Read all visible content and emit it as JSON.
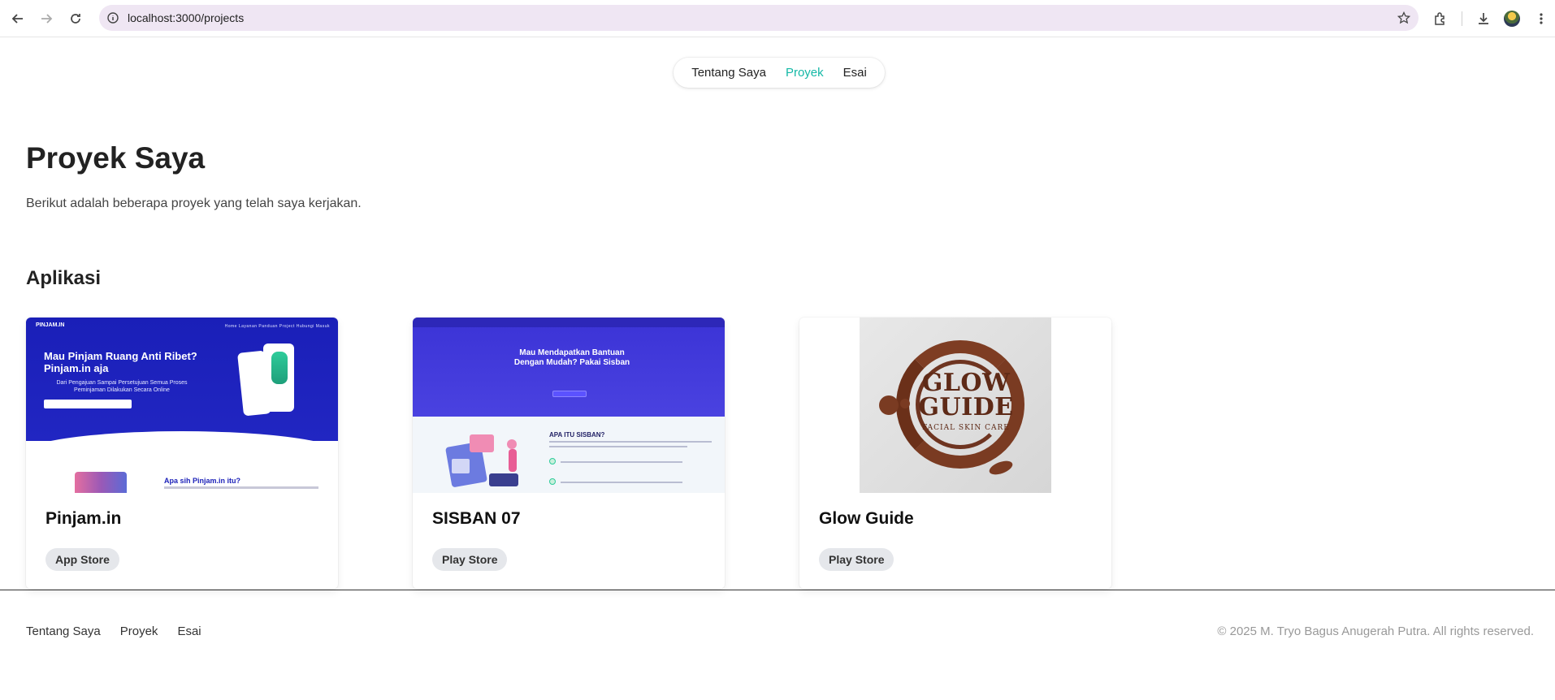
{
  "browser": {
    "url": "localhost:3000/projects",
    "icons": [
      "back-icon",
      "forward-icon",
      "reload-icon",
      "site-info-icon",
      "bookmark-star-icon",
      "extensions-icon",
      "downloads-icon",
      "profile-avatar",
      "more-menu-icon"
    ]
  },
  "nav": {
    "items": [
      {
        "label": "Tentang Saya",
        "active": false
      },
      {
        "label": "Proyek",
        "active": true
      },
      {
        "label": "Esai",
        "active": false
      }
    ],
    "active_color": "#14b8a6"
  },
  "page": {
    "title": "Proyek Saya",
    "subtitle": "Berikut adalah beberapa proyek yang telah saya kerjakan."
  },
  "section": {
    "title": "Aplikasi"
  },
  "projects": [
    {
      "title": "Pinjam.in",
      "store": "App Store",
      "thumb": {
        "logo": "PINJAM.IN",
        "menu": "Home   Layanan   Panduan   Project   Hubungi   Masuk",
        "headline_1": "Mau Pinjam Ruang Anti Ribet?",
        "headline_2": "Pinjam.in aja",
        "sub": "Dari Pengajuan Sampai Persetujuan Semua Proses Peminjaman Dilakukan Secara Online",
        "section": "Apa sih Pinjam.in itu?"
      }
    },
    {
      "title": "SISBAN 07",
      "store": "Play Store",
      "thumb": {
        "headline_1": "Mau Mendapatkan Bantuan",
        "headline_2": "Dengan Mudah? Pakai Sisban",
        "section": "APA ITU SISBAN?"
      }
    },
    {
      "title": "Glow Guide",
      "store": "Play Store",
      "thumb": {
        "logo_line_1": "GLOW",
        "logo_line_2": "GUIDE",
        "logo_sub": "FACIAL SKIN CARE"
      }
    }
  ],
  "footer": {
    "links": [
      "Tentang Saya",
      "Proyek",
      "Esai"
    ],
    "copyright": "© 2025 M. Tryo Bagus Anugerah Putra. All rights reserved."
  }
}
